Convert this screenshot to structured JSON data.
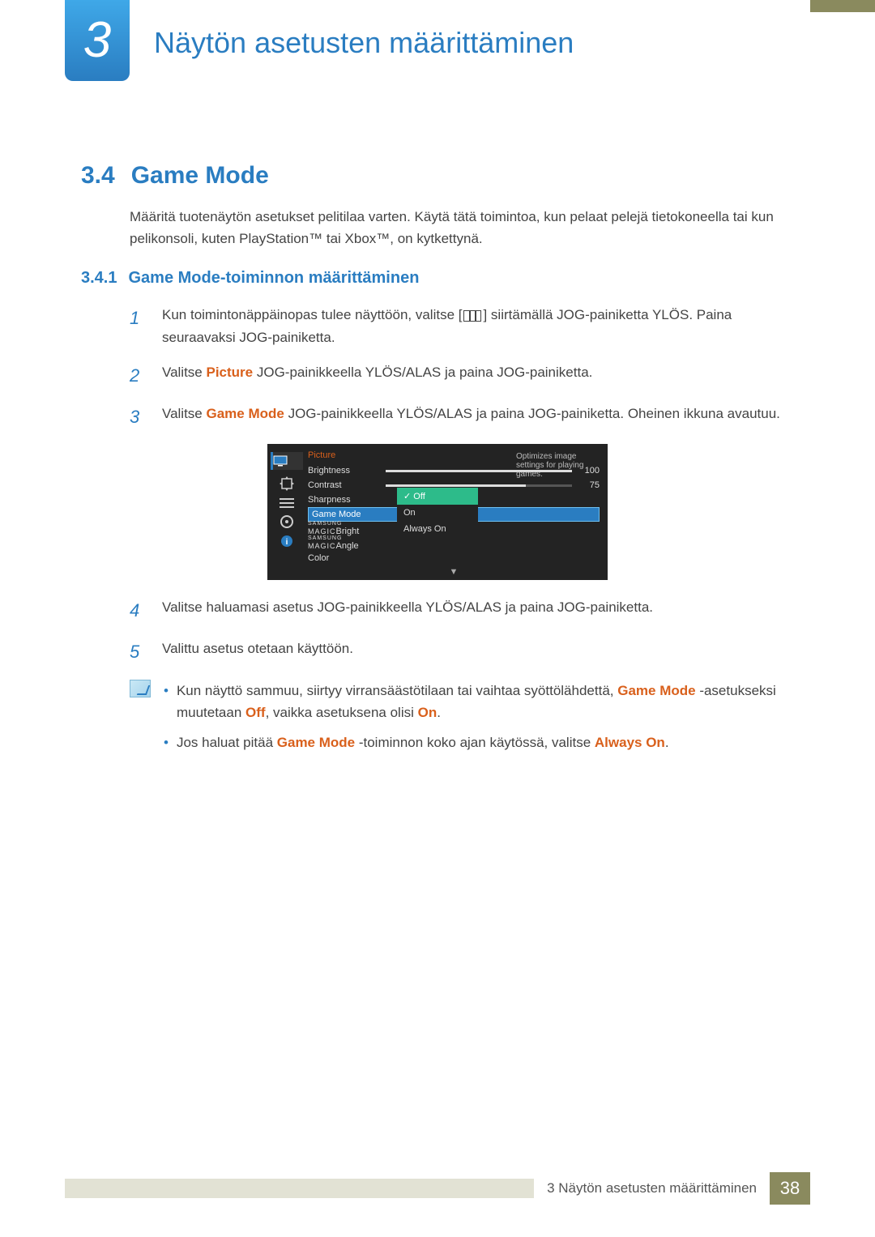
{
  "chapter": {
    "number": "3",
    "title": "Näytön asetusten määittäminen",
    "title_full": "Näytön asetusten määrittäminen"
  },
  "section": {
    "num": "3.4",
    "title": "Game Mode",
    "intro": "Määritä tuotenäytön asetukset pelitilaa varten. Käytä tätä toimintoa, kun pelaat pelejä tietokoneella tai kun pelikonsoli, kuten PlayStation™ tai Xbox™, on kytkettynä."
  },
  "subsection": {
    "num": "3.4.1",
    "title": "Game Mode-toiminnon määrittäminen"
  },
  "steps": {
    "s1": {
      "num": "1",
      "a": "Kun toimintonäppäinopas tulee näyttöön, valitse [",
      "b": "] siirtämällä JOG-painiketta YLÖS. Paina seuraavaksi JOG-painiketta."
    },
    "s2": {
      "num": "2",
      "prefix": "Valitse ",
      "hl": "Picture",
      "suffix": " JOG-painikkeella YLÖS/ALAS ja paina JOG-painiketta."
    },
    "s3": {
      "num": "3",
      "prefix": "Valitse ",
      "hl": "Game Mode",
      "suffix": " JOG-painikkeella YLÖS/ALAS ja paina JOG-painiketta. Oheinen ikkuna avautuu."
    },
    "s4": {
      "num": "4",
      "text": "Valitse haluamasi asetus JOG-painikkeella YLÖS/ALAS ja paina JOG-painiketta."
    },
    "s5": {
      "num": "5",
      "text": "Valittu asetus otetaan käyttöön."
    }
  },
  "osd": {
    "title": "Picture",
    "tooltip": "Optimizes image settings for playing games.",
    "items": {
      "brightness": {
        "label": "Brightness",
        "value": "100",
        "fill": 100
      },
      "contrast": {
        "label": "Contrast",
        "value": "75",
        "fill": 75
      },
      "sharpness": {
        "label": "Sharpness"
      },
      "game_mode": {
        "label": "Game Mode"
      },
      "magic_bright": {
        "upper": "SAMSUNG",
        "lower": "MAGIC",
        "suffix": "Bright"
      },
      "magic_angle": {
        "upper": "SAMSUNG",
        "lower": "MAGIC",
        "suffix": "Angle"
      },
      "color": {
        "label": "Color"
      }
    },
    "popup": {
      "off": "Off",
      "on": "On",
      "always": "Always On"
    },
    "check": "✓",
    "arrow": "▼"
  },
  "notes": {
    "n1": {
      "a": "Kun näyttö sammuu, siirtyy virransäästötilaan tai vaihtaa syöttölähdettä, ",
      "hl1": "Game Mode",
      "b": " -asetukseksi muutetaan ",
      "hl2": "Off",
      "c": ", vaikka asetuksena olisi ",
      "hl3": "On",
      "d": "."
    },
    "n2": {
      "a": "Jos haluat pitää ",
      "hl1": "Game Mode",
      "b": " -toiminnon koko ajan käytössä, valitse ",
      "hl2": "Always On",
      "c": "."
    }
  },
  "footer": {
    "text": "3 Näytön asetusten määrittäminen",
    "page": "38"
  }
}
